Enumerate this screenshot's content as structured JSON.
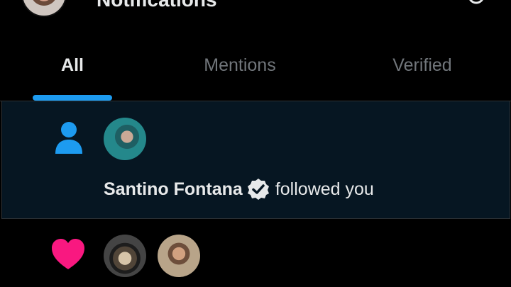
{
  "header": {
    "title": "Notifications"
  },
  "tabs": [
    {
      "label": "All",
      "active": true
    },
    {
      "label": "Mentions",
      "active": false
    },
    {
      "label": "Verified",
      "active": false
    }
  ],
  "notifications": [
    {
      "type": "follow",
      "icon": "person-icon",
      "actor": "Santino Fontana",
      "verified": true,
      "action": "followed you"
    },
    {
      "type": "like",
      "icon": "heart-icon"
    }
  ],
  "colors": {
    "accent": "#1d9bf0",
    "heart": "#f91880",
    "background": "#000000",
    "highlight": "#061622"
  }
}
